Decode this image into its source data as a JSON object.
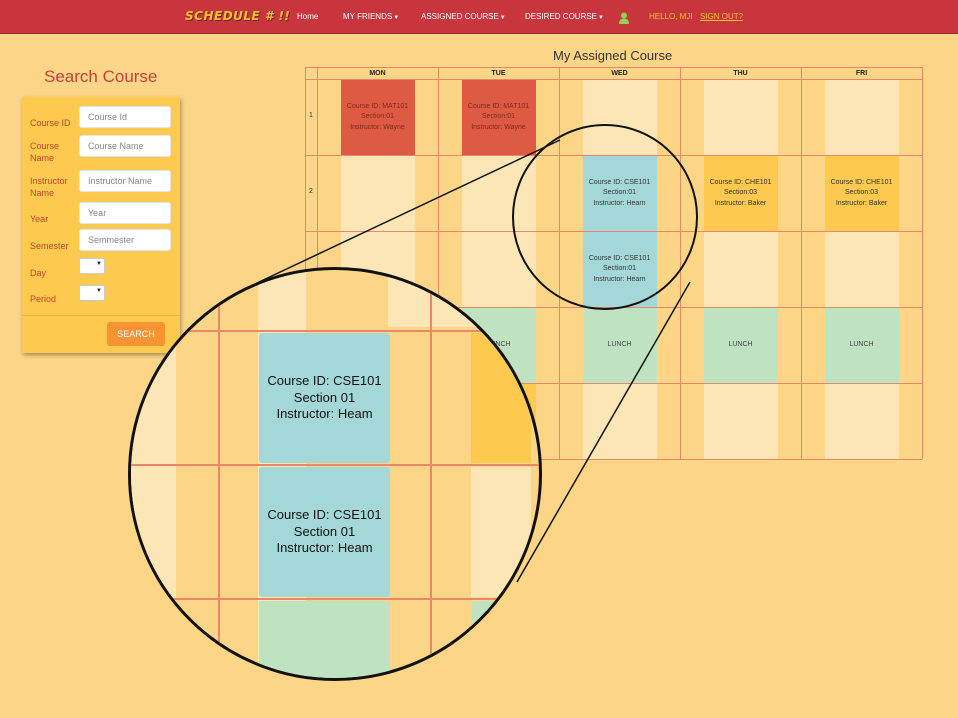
{
  "navbar": {
    "brand": "SCHEDULE # !!",
    "items": [
      {
        "label": "Home",
        "has_caret": false
      },
      {
        "label": "MY FRIENDS",
        "has_caret": true
      },
      {
        "label": "ASSIGNED COURSE",
        "has_caret": true
      },
      {
        "label": "DESIRED COURSE",
        "has_caret": true
      }
    ],
    "user_icon": "user-icon",
    "greeting": "HELLO, MJI",
    "signout": "SIGN OUT?",
    "brand_color": "#c8353d",
    "accent_color": "#f6c033"
  },
  "search": {
    "title": "Search Course",
    "fields": [
      {
        "label": "Course ID",
        "placeholder": "Course Id",
        "value": ""
      },
      {
        "label": "Course Name",
        "placeholder": "Course Name",
        "value": ""
      },
      {
        "label": "Instructor Name",
        "placeholder": "Instructor Name",
        "value": ""
      },
      {
        "label": "Year",
        "placeholder": "Year",
        "value": ""
      },
      {
        "label": "Semester",
        "placeholder": "Semmester",
        "value": ""
      }
    ],
    "selects": [
      {
        "label": "Day",
        "value": ""
      },
      {
        "label": "Period",
        "value": ""
      }
    ],
    "button": "SEARCH",
    "button_color": "#f79332"
  },
  "schedule": {
    "title": "My Assigned Course",
    "days": [
      "MON",
      "TUE",
      "WED",
      "THU",
      "FRI"
    ],
    "periods": [
      "1",
      "2",
      "",
      "",
      ""
    ],
    "colors": {
      "red": "#df5a42",
      "blue": "#a4d8d8",
      "yellow": "#fdc94e",
      "green": "#bfe2c0",
      "empty": "#fde6b6"
    },
    "rows": [
      [
        {
          "type": "red",
          "lines": [
            "Course ID: MAT101",
            "Section:01",
            "Instructor: Wayne"
          ]
        },
        {
          "type": "red",
          "lines": [
            "Course ID: MAT101",
            "Section:01",
            "Instructor: Wayne"
          ]
        },
        {
          "type": "empty",
          "lines": []
        },
        {
          "type": "empty",
          "lines": []
        },
        {
          "type": "empty",
          "lines": []
        }
      ],
      [
        {
          "type": "empty",
          "lines": []
        },
        {
          "type": "empty",
          "lines": []
        },
        {
          "type": "blue",
          "lines": [
            "Course ID: CSE101",
            "Section:01",
            "Instructor: Hearn"
          ]
        },
        {
          "type": "yellow",
          "lines": [
            "Course ID: CHE101",
            "Section:03",
            "Instructor: Baker"
          ]
        },
        {
          "type": "yellow",
          "lines": [
            "Course ID: CHE101",
            "Section:03",
            "Instructor: Baker"
          ]
        }
      ],
      [
        {
          "type": "empty",
          "lines": []
        },
        {
          "type": "empty",
          "lines": []
        },
        {
          "type": "blue",
          "lines": [
            "Course ID: CSE101",
            "Section:01",
            "Instructor: Hearn"
          ]
        },
        {
          "type": "empty",
          "lines": []
        },
        {
          "type": "empty",
          "lines": []
        }
      ],
      [
        {
          "type": "empty",
          "lines": []
        },
        {
          "type": "green",
          "lines": [
            "LUNCH"
          ]
        },
        {
          "type": "green",
          "lines": [
            "LUNCH"
          ]
        },
        {
          "type": "green",
          "lines": [
            "LUNCH"
          ]
        },
        {
          "type": "green",
          "lines": [
            "LUNCH"
          ]
        }
      ],
      [
        {
          "type": "empty",
          "lines": []
        },
        {
          "type": "yellow",
          "lines": []
        },
        {
          "type": "empty",
          "lines": []
        },
        {
          "type": "empty",
          "lines": []
        },
        {
          "type": "empty",
          "lines": []
        }
      ]
    ]
  },
  "magnifier": {
    "cells": [
      {
        "lines": [
          "Course ID: CSE101",
          "Section 01",
          "Instructor: Heam"
        ]
      },
      {
        "lines": [
          "Course ID: CSE101",
          "Section 01",
          "Instructor: Heam"
        ]
      }
    ]
  }
}
